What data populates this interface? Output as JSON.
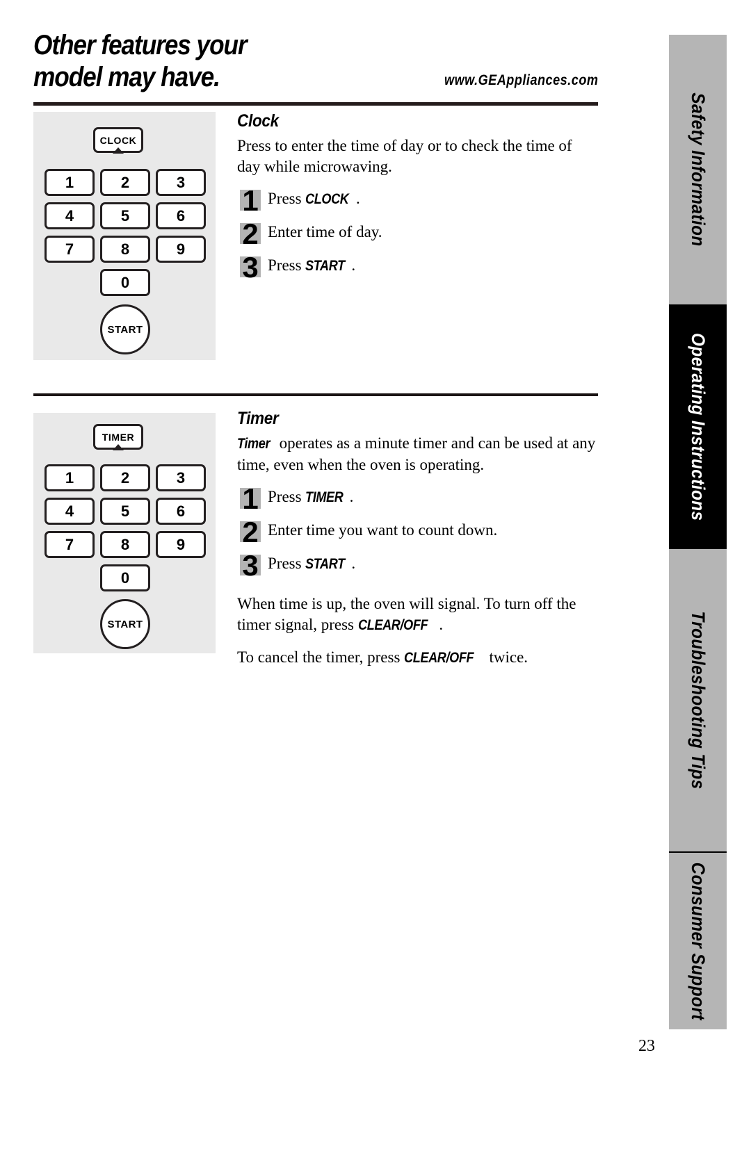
{
  "header": {
    "title_line1": "Other features your",
    "title_line2": "model may have.",
    "url": "www.GEAppliances.com"
  },
  "sections": [
    {
      "id": "clock",
      "heading": "Clock",
      "intro": "Press to enter the time of day or to check the time of day while microwaving.",
      "steps": [
        {
          "num": "1",
          "pre": "Press ",
          "emph": "CLOCK",
          "post": "."
        },
        {
          "num": "2",
          "pre": "Enter time of day.",
          "emph": "",
          "post": ""
        },
        {
          "num": "3",
          "pre": "Press ",
          "emph": "START",
          "post": "."
        }
      ],
      "panel": {
        "function_key": "CLOCK",
        "keys": [
          "1",
          "2",
          "3",
          "4",
          "5",
          "6",
          "7",
          "8",
          "9",
          "0"
        ],
        "start_key": "START"
      }
    },
    {
      "id": "timer",
      "heading": "Timer",
      "intro_emph": "Timer",
      "intro": " operates as a minute timer and can be used at any time, even when the oven is operating.",
      "steps": [
        {
          "num": "1",
          "pre": "Press ",
          "emph": "TIMER",
          "post": "."
        },
        {
          "num": "2",
          "pre": "Enter time you want to count down.",
          "emph": "",
          "post": ""
        },
        {
          "num": "3",
          "pre": "Press ",
          "emph": "START",
          "post": "."
        }
      ],
      "tail_paragraphs": [
        {
          "pre": "When time is up, the oven will signal. To turn off the timer signal, press ",
          "emph": "CLEAR/OFF",
          "post": "."
        },
        {
          "pre": "To cancel the timer, press ",
          "emph": "CLEAR/OFF",
          "post": " twice."
        }
      ],
      "panel": {
        "function_key": "TIMER",
        "keys": [
          "1",
          "2",
          "3",
          "4",
          "5",
          "6",
          "7",
          "8",
          "9",
          "0"
        ],
        "start_key": "START"
      }
    }
  ],
  "tabs": [
    {
      "label": "Safety Information",
      "active": false
    },
    {
      "label": "Operating Instructions",
      "active": true
    },
    {
      "label": "Troubleshooting Tips",
      "active": false
    },
    {
      "label": "Consumer Support",
      "active": false
    }
  ],
  "page_number": "23",
  "colors": {
    "panel_background": "#e9e9e9",
    "tab_inactive": "#b5b5b5",
    "tab_active": "#000000",
    "step_badge": "#b3b3b3",
    "rule": "#241c1c"
  }
}
